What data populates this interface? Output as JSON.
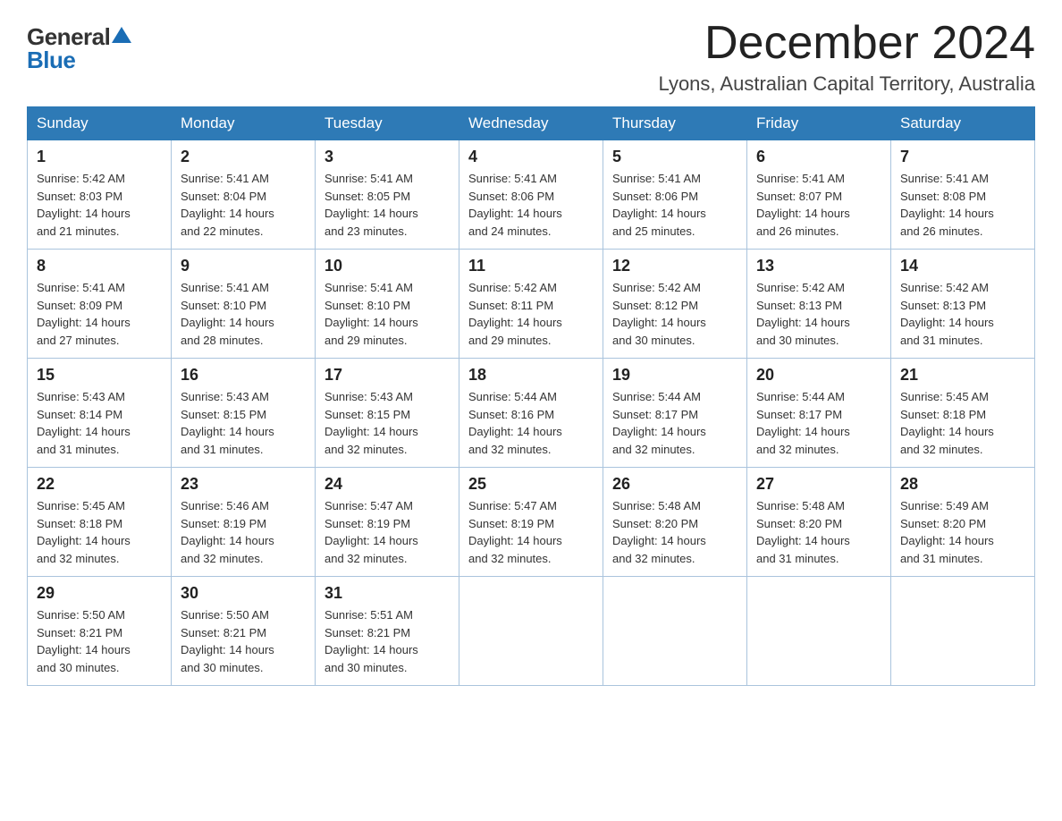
{
  "logo": {
    "general": "General",
    "blue": "Blue"
  },
  "title": "December 2024",
  "location": "Lyons, Australian Capital Territory, Australia",
  "weekdays": [
    "Sunday",
    "Monday",
    "Tuesday",
    "Wednesday",
    "Thursday",
    "Friday",
    "Saturday"
  ],
  "weeks": [
    [
      {
        "day": "1",
        "sunrise": "5:42 AM",
        "sunset": "8:03 PM",
        "daylight": "14 hours and 21 minutes."
      },
      {
        "day": "2",
        "sunrise": "5:41 AM",
        "sunset": "8:04 PM",
        "daylight": "14 hours and 22 minutes."
      },
      {
        "day": "3",
        "sunrise": "5:41 AM",
        "sunset": "8:05 PM",
        "daylight": "14 hours and 23 minutes."
      },
      {
        "day": "4",
        "sunrise": "5:41 AM",
        "sunset": "8:06 PM",
        "daylight": "14 hours and 24 minutes."
      },
      {
        "day": "5",
        "sunrise": "5:41 AM",
        "sunset": "8:06 PM",
        "daylight": "14 hours and 25 minutes."
      },
      {
        "day": "6",
        "sunrise": "5:41 AM",
        "sunset": "8:07 PM",
        "daylight": "14 hours and 26 minutes."
      },
      {
        "day": "7",
        "sunrise": "5:41 AM",
        "sunset": "8:08 PM",
        "daylight": "14 hours and 26 minutes."
      }
    ],
    [
      {
        "day": "8",
        "sunrise": "5:41 AM",
        "sunset": "8:09 PM",
        "daylight": "14 hours and 27 minutes."
      },
      {
        "day": "9",
        "sunrise": "5:41 AM",
        "sunset": "8:10 PM",
        "daylight": "14 hours and 28 minutes."
      },
      {
        "day": "10",
        "sunrise": "5:41 AM",
        "sunset": "8:10 PM",
        "daylight": "14 hours and 29 minutes."
      },
      {
        "day": "11",
        "sunrise": "5:42 AM",
        "sunset": "8:11 PM",
        "daylight": "14 hours and 29 minutes."
      },
      {
        "day": "12",
        "sunrise": "5:42 AM",
        "sunset": "8:12 PM",
        "daylight": "14 hours and 30 minutes."
      },
      {
        "day": "13",
        "sunrise": "5:42 AM",
        "sunset": "8:13 PM",
        "daylight": "14 hours and 30 minutes."
      },
      {
        "day": "14",
        "sunrise": "5:42 AM",
        "sunset": "8:13 PM",
        "daylight": "14 hours and 31 minutes."
      }
    ],
    [
      {
        "day": "15",
        "sunrise": "5:43 AM",
        "sunset": "8:14 PM",
        "daylight": "14 hours and 31 minutes."
      },
      {
        "day": "16",
        "sunrise": "5:43 AM",
        "sunset": "8:15 PM",
        "daylight": "14 hours and 31 minutes."
      },
      {
        "day": "17",
        "sunrise": "5:43 AM",
        "sunset": "8:15 PM",
        "daylight": "14 hours and 32 minutes."
      },
      {
        "day": "18",
        "sunrise": "5:44 AM",
        "sunset": "8:16 PM",
        "daylight": "14 hours and 32 minutes."
      },
      {
        "day": "19",
        "sunrise": "5:44 AM",
        "sunset": "8:17 PM",
        "daylight": "14 hours and 32 minutes."
      },
      {
        "day": "20",
        "sunrise": "5:44 AM",
        "sunset": "8:17 PM",
        "daylight": "14 hours and 32 minutes."
      },
      {
        "day": "21",
        "sunrise": "5:45 AM",
        "sunset": "8:18 PM",
        "daylight": "14 hours and 32 minutes."
      }
    ],
    [
      {
        "day": "22",
        "sunrise": "5:45 AM",
        "sunset": "8:18 PM",
        "daylight": "14 hours and 32 minutes."
      },
      {
        "day": "23",
        "sunrise": "5:46 AM",
        "sunset": "8:19 PM",
        "daylight": "14 hours and 32 minutes."
      },
      {
        "day": "24",
        "sunrise": "5:47 AM",
        "sunset": "8:19 PM",
        "daylight": "14 hours and 32 minutes."
      },
      {
        "day": "25",
        "sunrise": "5:47 AM",
        "sunset": "8:19 PM",
        "daylight": "14 hours and 32 minutes."
      },
      {
        "day": "26",
        "sunrise": "5:48 AM",
        "sunset": "8:20 PM",
        "daylight": "14 hours and 32 minutes."
      },
      {
        "day": "27",
        "sunrise": "5:48 AM",
        "sunset": "8:20 PM",
        "daylight": "14 hours and 31 minutes."
      },
      {
        "day": "28",
        "sunrise": "5:49 AM",
        "sunset": "8:20 PM",
        "daylight": "14 hours and 31 minutes."
      }
    ],
    [
      {
        "day": "29",
        "sunrise": "5:50 AM",
        "sunset": "8:21 PM",
        "daylight": "14 hours and 30 minutes."
      },
      {
        "day": "30",
        "sunrise": "5:50 AM",
        "sunset": "8:21 PM",
        "daylight": "14 hours and 30 minutes."
      },
      {
        "day": "31",
        "sunrise": "5:51 AM",
        "sunset": "8:21 PM",
        "daylight": "14 hours and 30 minutes."
      },
      null,
      null,
      null,
      null
    ]
  ],
  "labels": {
    "sunrise": "Sunrise:",
    "sunset": "Sunset:",
    "daylight": "Daylight:"
  }
}
